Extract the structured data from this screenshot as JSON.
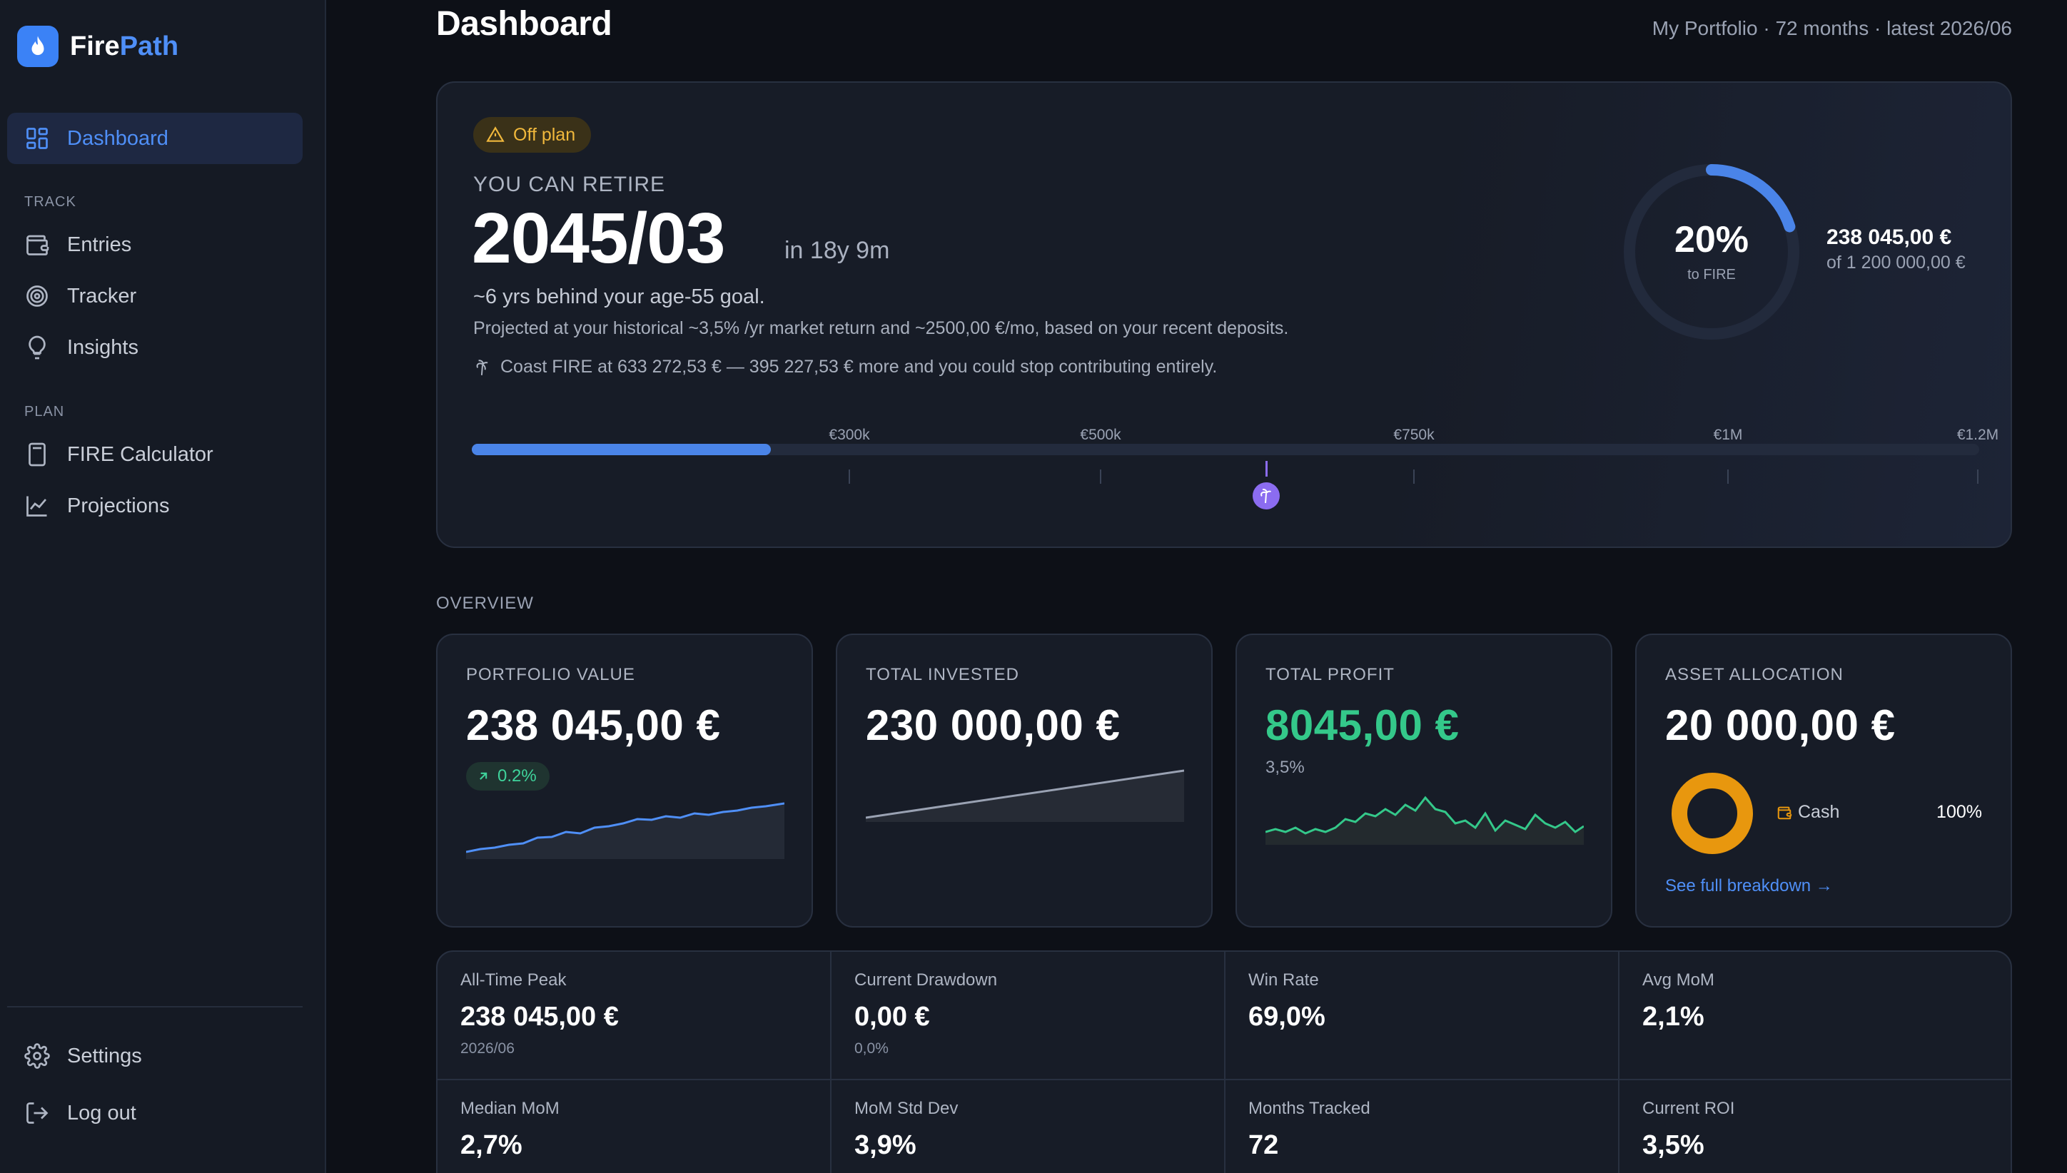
{
  "app": {
    "name_part1": "Fire",
    "name_part2": "Path",
    "logo_icon": "flame-icon"
  },
  "sidebar": {
    "nav_dashboard": "Dashboard",
    "section_track": "TRACK",
    "nav_entries": "Entries",
    "nav_tracker": "Tracker",
    "nav_insights": "Insights",
    "section_plan": "PLAN",
    "nav_fire_calculator": "FIRE Calculator",
    "nav_projections": "Projections",
    "nav_settings": "Settings",
    "nav_logout": "Log out",
    "active": "Dashboard"
  },
  "header": {
    "title": "Dashboard",
    "subtitle": "My Portfolio · 72 months · latest 2026/06"
  },
  "hero": {
    "badge": "Off plan",
    "label": "YOU CAN RETIRE",
    "date": "2045/03",
    "in_time": "in 18y 9m",
    "behind": "~6 yrs behind your age-55 goal.",
    "projected": "Projected at your historical ~3,5% /yr market return and ~2500,00 €/mo, based on your recent deposits.",
    "coast": "Coast FIRE at 633 272,53 € — 395 227,53 € more and you could stop contributing entirely.",
    "ring_percent": "20%",
    "ring_label": "to FIRE",
    "ring_fraction": 0.2,
    "amount": "238 045,00 €",
    "target": "of 1 200 000,00 €",
    "track_ticks": [
      "€300k",
      "€500k",
      "€750k",
      "€1M",
      "€1.2M"
    ],
    "track_current_value": 238045,
    "track_max_value": 1200000,
    "coast_value": 633272.53
  },
  "overview": {
    "label": "OVERVIEW",
    "portfolio_title": "PORTFOLIO VALUE",
    "portfolio_value": "238 045,00 €",
    "portfolio_change": "0.2%",
    "invested_title": "TOTAL INVESTED",
    "invested_value": "230 000,00 €",
    "profit_title": "TOTAL PROFIT",
    "profit_value": "8045,00 €",
    "profit_pct": "3,5%",
    "alloc_title": "ASSET ALLOCATION",
    "alloc_value": "20 000,00 €",
    "alloc_name": "Cash",
    "alloc_pct": "100%",
    "alloc_link": "See full breakdown →"
  },
  "stats": {
    "peak_label": "All-Time Peak",
    "peak_value": "238 045,00 €",
    "peak_sub": "2026/06",
    "drawdown_label": "Current Drawdown",
    "drawdown_value": "0,00 €",
    "drawdown_sub": "0,0%",
    "winrate_label": "Win Rate",
    "winrate_value": "69,0%",
    "avgmom_label": "Avg MoM",
    "avgmom_value": "2,1%",
    "median_label": "Median MoM",
    "median_value": "2,7%",
    "std_label": "MoM Std Dev",
    "std_value": "3,9%",
    "months_label": "Months Tracked",
    "months_value": "72",
    "roi_label": "Current ROI",
    "roi_value": "3,5%"
  },
  "colors": {
    "accent": "#4f8ff7",
    "profit": "#34c88a",
    "warning": "#f0b83c",
    "coast": "#8b6cf0",
    "cash": "#e8970e"
  }
}
